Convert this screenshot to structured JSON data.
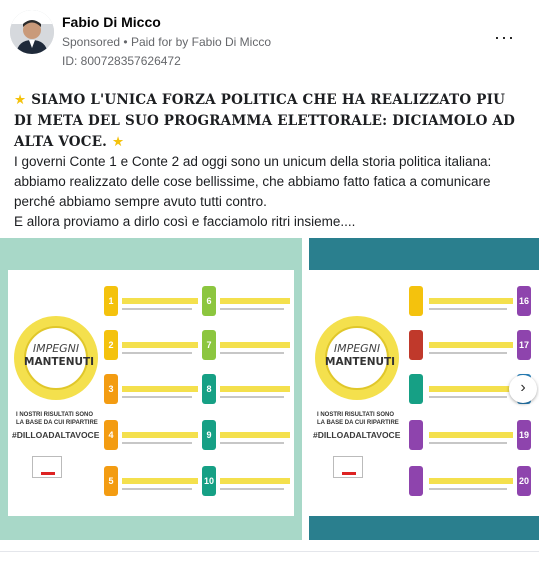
{
  "post": {
    "author": "Fabio Di Micco",
    "sponsored_label": "Sponsored",
    "separator": "•",
    "paid_for_prefix": "Paid for by",
    "paid_for_name": "Fabio Di Micco",
    "id_line": "ID: 800728357626472",
    "more_icon": "···",
    "headline": "SIAMO L'UNICA FORZA POLITICA CHE HA REALIZZATO PIU DI META DEL SUO PROGRAMMA ELETTORALE: DICIAMOLO AD ALTA VOCE.",
    "star_icon": "★",
    "body_lines": [
      "I governi Conte 1 e Conte 2 ad oggi sono un unicum della storia politica italiana:",
      "abbiamo realizzato delle cose bellissime, che abbiamo fatto fatica a comunicare perché abbiamo sempre avuto tutti contro.",
      "E allora proviamo a dirlo così e facciamolo ritri insieme...."
    ]
  },
  "gallery": {
    "card1": {
      "impegni": "IMPEGNI",
      "mantenuti": "MANTENUTI",
      "subtitle_1": "I NOSTRI RISULTATI SONO",
      "subtitle_2": "LA BASE DA CUI RIPARTIRE",
      "hashtag": "#DILLOADALTAVOCE",
      "numbers": [
        "1",
        "2",
        "3",
        "4",
        "5",
        "6",
        "7",
        "8",
        "9",
        "10"
      ]
    },
    "card2": {
      "impegni": "IMPEGNI",
      "mantenuti": "MANTENUTI",
      "subtitle_1": "I NOSTRI RISULTATI SONO",
      "subtitle_2": "LA BASE DA CUI RIPARTIRE",
      "hashtag": "#DILLOADALTAVOCE",
      "numbers": [
        "16",
        "17",
        "18",
        "19",
        "20"
      ]
    },
    "next_icon": "›"
  },
  "colors": {
    "num_green": "#8cc63f",
    "num_yellow": "#f4c20d",
    "num_orange": "#f39c12",
    "num_teal": "#16a085",
    "num_purple": "#8e44ad",
    "num_blue": "#2980b9",
    "num_red": "#c0392b"
  }
}
